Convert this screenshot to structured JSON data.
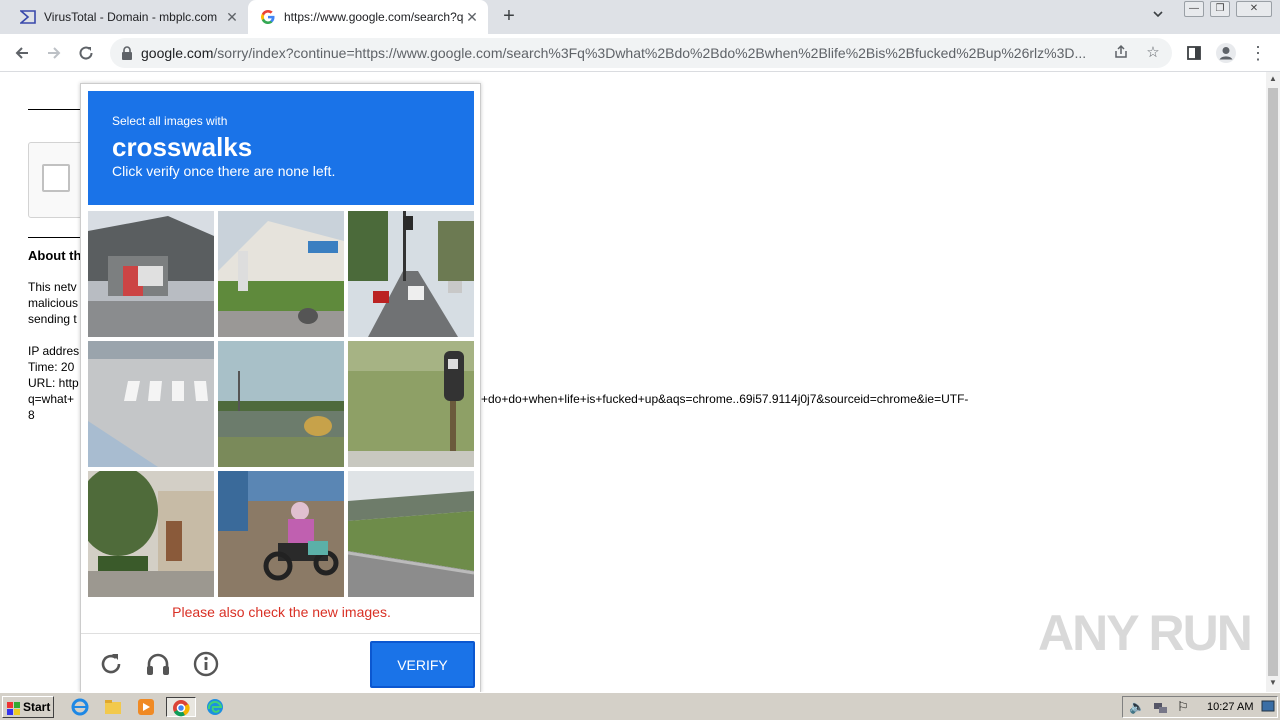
{
  "tabs": [
    {
      "title": "VirusTotal - Domain - mbplc.com",
      "icon": "virustotal-icon"
    },
    {
      "title": "https://www.google.com/search?q=",
      "icon": "google-icon"
    }
  ],
  "address_bar": {
    "host": "google.com",
    "path": "/sorry/index?continue=https://www.google.com/search%3Fq%3Dwhat%2Bdo%2Bdo%2Bwhen%2Blife%2Bis%2Bfucked%2Bup%26rlz%3D..."
  },
  "background_page": {
    "about_heading": "About th",
    "line1": "This netv",
    "line2": "malicious",
    "line3": "sending t",
    "ip_label": "IP addres",
    "time_label": "Time: 20",
    "url_label": "URL: http",
    "query_start": "q=what+",
    "query_rest": "+do+do+when+life+is+fucked+up&aqs=chrome..69i57.9114j0j7&sourceid=chrome&ie=UTF-",
    "query_end": "8"
  },
  "challenge": {
    "subtitle": "Select all images with",
    "target": "crosswalks",
    "instruction": "Click verify once there are none left.",
    "error": "Please also check the new images.",
    "verify_label": "VERIFY"
  },
  "watermark": "ANY RUN",
  "taskbar": {
    "start_label": "Start",
    "clock": "10:27 AM"
  },
  "colors": {
    "recaptcha_blue": "#1a73e8",
    "error_red": "#d93025"
  }
}
